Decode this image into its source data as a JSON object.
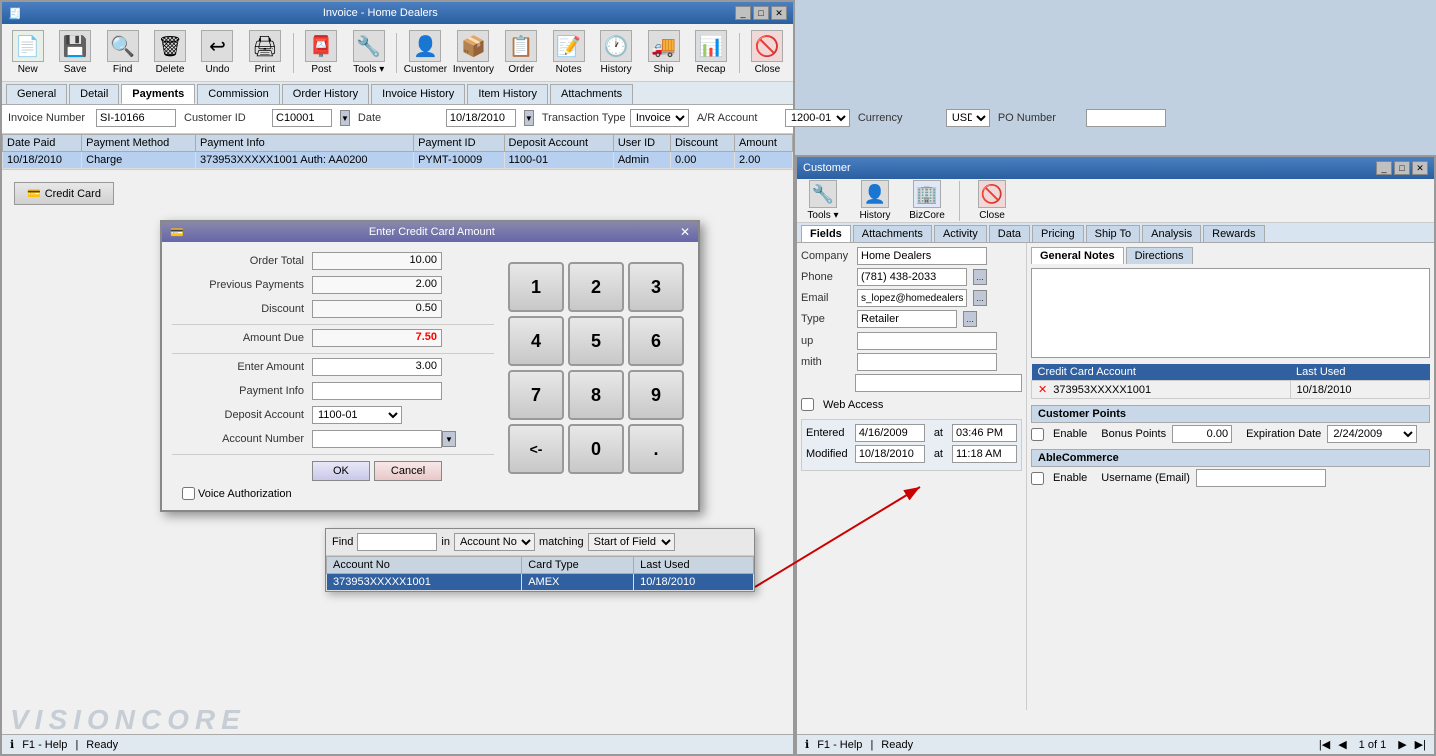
{
  "mainWindow": {
    "title": "Invoice - Home Dealers",
    "tabs": [
      "General",
      "Detail",
      "Payments",
      "Commission",
      "Order History",
      "Invoice History",
      "Item History",
      "Attachments"
    ],
    "activeTab": "Payments",
    "toolbar": {
      "items": [
        "New",
        "Save",
        "Find",
        "Delete",
        "Undo",
        "Print",
        "Post",
        "Tools",
        "Customer",
        "Inventory",
        "Order",
        "Notes",
        "History",
        "Ship",
        "Recap",
        "Close"
      ]
    },
    "formFields": {
      "invoiceNumberLabel": "Invoice Number",
      "invoiceNumber": "SI-10166",
      "customerIdLabel": "Customer ID",
      "customerId": "C10001",
      "dateLabel": "Date",
      "date": "10/18/2010",
      "transactionTypeLabel": "Transaction Type",
      "transactionType": "Invoice",
      "arAccountLabel": "A/R Account",
      "arAccount": "1200-01",
      "currencyLabel": "Currency",
      "currency": "USD",
      "poNumberLabel": "PO Number",
      "poNumber": ""
    },
    "grid": {
      "columns": [
        "Date Paid",
        "Payment Method",
        "Payment Info",
        "Payment ID",
        "Deposit Account",
        "User ID",
        "Discount",
        "Amount"
      ],
      "rows": [
        {
          "datePaid": "10/18/2010",
          "paymentMethod": "Charge",
          "paymentInfo": "373953XXXXX1001 Auth: AA0200",
          "paymentId": "PYMT-10009",
          "depositAccount": "1100-01",
          "userId": "Admin",
          "discount": "0.00",
          "amount": "2.00"
        }
      ]
    },
    "creditCardBtn": "Credit Card",
    "statusBar": {
      "help": "F1 - Help",
      "status": "Ready"
    }
  },
  "dialog": {
    "title": "Enter Credit Card Amount",
    "fields": {
      "orderTotalLabel": "Order Total",
      "orderTotal": "10.00",
      "previousPaymentsLabel": "Previous Payments",
      "previousPayments": "2.00",
      "discountLabel": "Discount",
      "discount": "0.50",
      "amountDueLabel": "Amount Due",
      "amountDue": "7.50",
      "enterAmountLabel": "Enter Amount",
      "enterAmount": "3.00",
      "paymentInfoLabel": "Payment Info",
      "paymentInfo": "",
      "depositAccountLabel": "Deposit Account",
      "depositAccount": "1100-01",
      "accountNumberLabel": "Account Number",
      "accountNumber": "",
      "voiceAuthLabel": "Voice Authorization",
      "voiceAuth": ""
    },
    "numpad": [
      "1",
      "2",
      "3",
      "4",
      "5",
      "6",
      "7",
      "8",
      "9",
      "<-",
      "0",
      "."
    ],
    "buttons": [
      "OK",
      "Cancel"
    ]
  },
  "findDropdown": {
    "findLabel": "Find",
    "findValue": "",
    "inLabel": "in",
    "inOption": "Account No",
    "matchingLabel": "matching",
    "matchingOption": "Start of Field",
    "columns": [
      "Account No",
      "Card Type",
      "Last Used"
    ],
    "rows": [
      {
        "accountNo": "373953XXXXX1001",
        "cardType": "AMEX",
        "lastUsed": "10/18/2010",
        "selected": true
      }
    ]
  },
  "customerWindow": {
    "tabs": [
      "Fields",
      "Attachments",
      "Activity",
      "Data",
      "Pricing",
      "Ship To",
      "Analysis",
      "Rewards"
    ],
    "activeTab": "Fields",
    "toolbar": {
      "items": [
        "Tools",
        "History",
        "BizCore",
        "Close"
      ]
    },
    "fields": {
      "companyLabel": "Company",
      "company": "Home Dealers",
      "phoneLabel": "Phone",
      "phone": "(781) 438-2033",
      "emailLabel": "Email",
      "email": "s_lopez@homedealers.com",
      "typeLabel": "Type",
      "type": "Retailer",
      "upLabel": "up",
      "mithLabel": "mith"
    },
    "notesTabs": [
      "General Notes",
      "Directions"
    ],
    "activeNotesTab": "General Notes",
    "creditCardSection": {
      "header": "Credit Card Account",
      "lastUsedLabel": "Last Used",
      "columns": [
        "Credit Card Account",
        "Last Used"
      ],
      "rows": [
        {
          "account": "373953XXXXX1001",
          "lastUsed": "10/18/2010",
          "selected": true
        }
      ]
    },
    "customerPoints": {
      "header": "Customer Points",
      "enableLabel": "Enable",
      "bonusPointsLabel": "Bonus Points",
      "bonusPoints": "0.00",
      "expirationDateLabel": "Expiration Date",
      "expirationDate": "2/24/2009"
    },
    "ableCommerce": {
      "header": "AbleCommerce",
      "enableLabel": "Enable",
      "usernameLabel": "Username (Email)",
      "username": ""
    },
    "webAccess": {
      "label": "Web Access"
    },
    "entered": {
      "label": "Entered",
      "date": "4/16/2009",
      "at": "at",
      "time": "03:46 PM"
    },
    "modified": {
      "label": "Modified",
      "date": "10/18/2010",
      "at": "at",
      "time": "11:18 AM"
    },
    "statusBar": {
      "help": "F1 - Help",
      "status": "Ready",
      "page": "1 of 1"
    }
  }
}
